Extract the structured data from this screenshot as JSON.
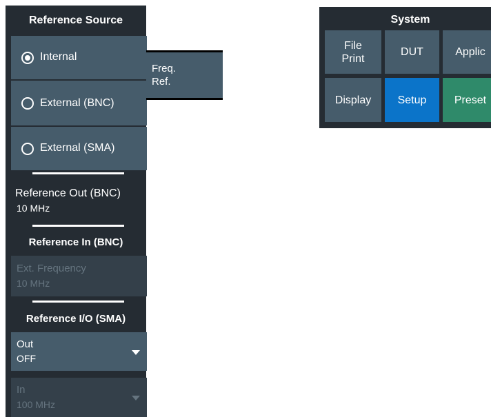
{
  "reference_panel": {
    "title": "Reference Source",
    "options": [
      {
        "label": "Internal",
        "selected": true
      },
      {
        "label": "External (BNC)",
        "selected": false
      },
      {
        "label": "External (SMA)",
        "selected": false
      }
    ],
    "ref_out": {
      "title": "Reference Out (BNC)",
      "value": "10 MHz"
    },
    "ref_in": {
      "title": "Reference In (BNC)",
      "field_label": "Ext. Frequency",
      "field_value": "10 MHz"
    },
    "ref_io": {
      "title": "Reference I/O (SMA)",
      "out": {
        "label": "Out",
        "value": "OFF"
      },
      "in": {
        "label": "In",
        "value": "100 MHz"
      }
    }
  },
  "freq_ref_tab": {
    "line1": "Freq.",
    "line2": "Ref."
  },
  "system_panel": {
    "title": "System",
    "buttons": [
      {
        "line1": "File",
        "line2": "Print"
      },
      {
        "label": "DUT"
      },
      {
        "label": "Applic"
      },
      {
        "label": "Display"
      },
      {
        "label": "Setup"
      },
      {
        "label": "Preset"
      }
    ]
  },
  "colors": {
    "panel_bg": "#252c33",
    "button_bg": "#465c6b",
    "setup_active": "#0b74c9",
    "preset": "#2f8a6a"
  }
}
